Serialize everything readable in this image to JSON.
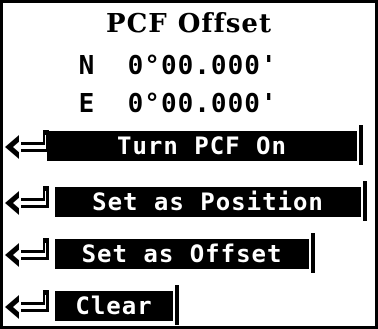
{
  "screen": {
    "title": "PCF Offset",
    "north": {
      "axis": "N",
      "value": "0°00.000'"
    },
    "east": {
      "axis": "E",
      "value": "0°00.000'"
    }
  },
  "menu": {
    "items": [
      {
        "label": "Turn PCF On",
        "icon": "enter-arrow-icon"
      },
      {
        "label": "Set as Position",
        "icon": "enter-arrow-icon"
      },
      {
        "label": "Set as Offset",
        "icon": "enter-arrow-icon"
      },
      {
        "label": "Clear",
        "icon": "enter-arrow-icon"
      }
    ]
  },
  "colors": {
    "foreground": "#000000",
    "background": "#ffffff"
  }
}
